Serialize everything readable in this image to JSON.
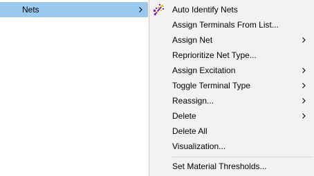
{
  "parent_menu": {
    "item_label": "Nets"
  },
  "submenu": {
    "items": [
      {
        "label": "Auto Identify Nets",
        "has_submenu": false,
        "icon": "auto-identify-nets-icon"
      },
      {
        "label": "Assign Terminals From List...",
        "has_submenu": false
      },
      {
        "label": "Assign Net",
        "has_submenu": true
      },
      {
        "label": "Reprioritize Net Type...",
        "has_submenu": false
      },
      {
        "label": "Assign Excitation",
        "has_submenu": true
      },
      {
        "label": "Toggle Terminal Type",
        "has_submenu": true
      },
      {
        "label": "Reassign...",
        "has_submenu": true
      },
      {
        "label": "Delete",
        "has_submenu": true
      },
      {
        "label": "Delete All",
        "has_submenu": false
      },
      {
        "label": "Visualization...",
        "has_submenu": false
      },
      {
        "label": "Set Material Thresholds...",
        "has_submenu": false
      }
    ]
  },
  "colors": {
    "highlight": "#99c9ef",
    "menu_background": "#f2f2f2",
    "border": "#cccccc",
    "icon_purple": "#7a1fa2",
    "icon_yellow": "#f2c200"
  }
}
